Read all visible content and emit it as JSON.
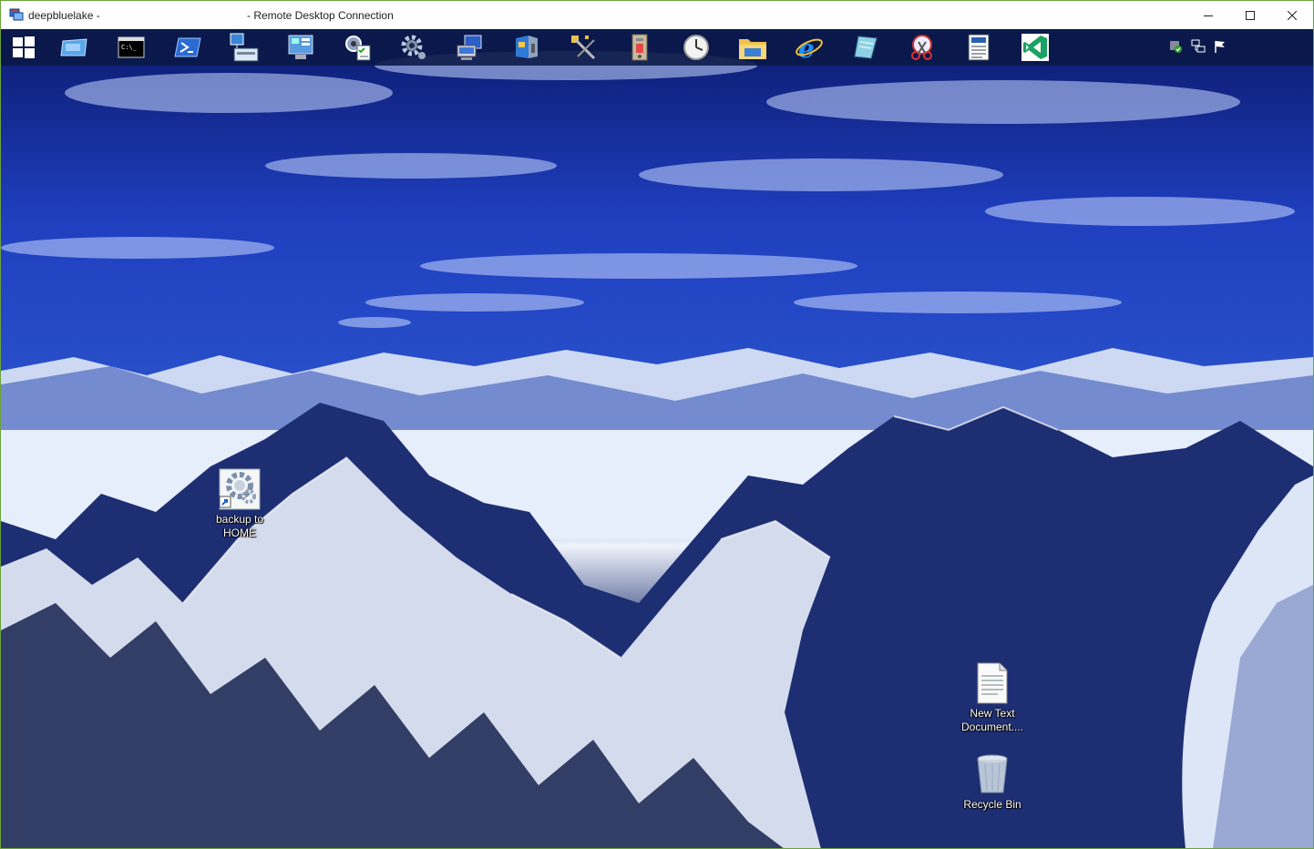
{
  "window": {
    "title_left": "deepbluelake -",
    "title_right": "- Remote Desktop Connection",
    "controls": {
      "minimize": "minimize-icon",
      "maximize": "maximize-icon",
      "close": "close-icon"
    }
  },
  "taskbar": {
    "items": [
      {
        "id": "start",
        "icon": "windows-logo-icon"
      },
      {
        "id": "explorer-folder",
        "icon": "folder-icon"
      },
      {
        "id": "command-prompt",
        "icon": "command-prompt-icon"
      },
      {
        "id": "powershell",
        "icon": "powershell-icon"
      },
      {
        "id": "network-tool",
        "icon": "network-computer-icon"
      },
      {
        "id": "control-panel",
        "icon": "control-panel-icon"
      },
      {
        "id": "task-settings",
        "icon": "settings-checklist-icon"
      },
      {
        "id": "gear",
        "icon": "gear-icon"
      },
      {
        "id": "remote-computer",
        "icon": "computer-network-icon"
      },
      {
        "id": "registry",
        "icon": "registry-icon"
      },
      {
        "id": "tools",
        "icon": "tools-icon"
      },
      {
        "id": "archive",
        "icon": "archive-icon"
      },
      {
        "id": "clock",
        "icon": "clock-icon"
      },
      {
        "id": "file-explorer",
        "icon": "file-explorer-icon"
      },
      {
        "id": "internet-explorer",
        "icon": "internet-explorer-icon"
      },
      {
        "id": "notes",
        "icon": "notepad-icon"
      },
      {
        "id": "snipping",
        "icon": "snipping-tool-icon"
      },
      {
        "id": "wordpad",
        "icon": "wordpad-icon"
      },
      {
        "id": "visual-studio",
        "icon": "visual-studio-icon"
      }
    ],
    "tray": [
      "security-shield-icon",
      "network-icon",
      "action-center-flag-icon"
    ]
  },
  "desktop": {
    "icons": [
      {
        "label_line1": "backup to",
        "label_line2": "HOME",
        "icon": "shortcut-gear-icon"
      },
      {
        "label_line1": "New Text",
        "label_line2": "Document....",
        "icon": "text-document-icon"
      },
      {
        "label_line1": "Recycle Bin",
        "label_line2": "",
        "icon": "recycle-bin-icon"
      }
    ]
  },
  "colors": {
    "title_bar_bg": "#ffffff",
    "window_border": "#6aa33a",
    "taskbar_bg": "#0a1846",
    "accent_green": "#1aa260"
  }
}
